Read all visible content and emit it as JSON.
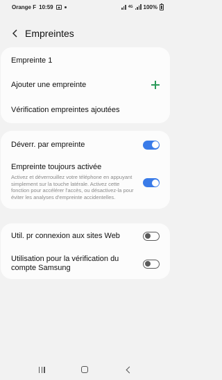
{
  "status_bar": {
    "carrier": "Orange F",
    "time": "10:59",
    "network_type": "4G",
    "battery": "100%"
  },
  "header": {
    "title": "Empreintes"
  },
  "fingerprints": {
    "items": [
      {
        "label": "Empreinte 1"
      }
    ],
    "add_label": "Ajouter une empreinte",
    "verify_label": "Vérification empreintes ajoutées"
  },
  "unlock": {
    "label": "Déverr. par empreinte",
    "enabled": true
  },
  "always_on": {
    "label": "Empreinte toujours activée",
    "description": "Activez et déverrouillez votre téléphone en appuyant simplement sur la touche latérale. Activez cette fonction pour accélérer l'accès, ou désactivez-la pour éviter les analyses d'empreinte accidentelles.",
    "enabled": true
  },
  "web_signin": {
    "label": "Util. pr connexion aux sites Web",
    "enabled": false
  },
  "samsung_account": {
    "label": "Utilisation pour la vérification du compte Samsung",
    "enabled": false
  },
  "colors": {
    "accent": "#3a7be8",
    "add_icon": "#2b9b5a",
    "background": "#f2f2f2",
    "card": "#fcfcfc"
  },
  "icons": {
    "back": "back-arrow-icon",
    "add": "plus-icon",
    "nav_recent": "recent-apps-icon",
    "nav_home": "home-icon",
    "nav_back": "nav-back-icon"
  }
}
